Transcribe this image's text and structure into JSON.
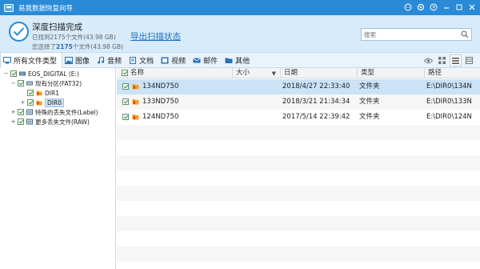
{
  "window": {
    "title": "易我数据恢复向导"
  },
  "header": {
    "status_title": "深度扫描完成",
    "found_prefix": "已找到",
    "found_count": "2175",
    "found_suffix": "个文件(43.98 GB)",
    "selected_prefix": "您选择了",
    "selected_count": "2175",
    "selected_suffix": "个文件(43.98 GB)",
    "export_link": "导出扫描状态",
    "search_placeholder": "搜索"
  },
  "toolbar": {
    "items": [
      {
        "label": "所有文件类型",
        "icon": "monitor-icon"
      },
      {
        "label": "图像",
        "icon": "image-icon"
      },
      {
        "label": "音频",
        "icon": "music-icon"
      },
      {
        "label": "文档",
        "icon": "document-icon"
      },
      {
        "label": "视频",
        "icon": "video-icon"
      },
      {
        "label": "邮件",
        "icon": "mail-icon"
      },
      {
        "label": "其他",
        "icon": "folder-icon"
      }
    ]
  },
  "tree": {
    "items": [
      {
        "label": "EOS_DIGITAL (E:)",
        "expander": "−"
      },
      {
        "label": "现有分区(FAT32)",
        "expander": "−"
      },
      {
        "label": "DIR1",
        "expander": ""
      },
      {
        "label": "DIR0",
        "expander": "+"
      },
      {
        "label": "特殊的丢失文件(Label)",
        "expander": "+"
      },
      {
        "label": "更多丢失文件(RAW)",
        "expander": "+"
      }
    ]
  },
  "table": {
    "columns": [
      "名称",
      "大小",
      "日期",
      "类型",
      "路径"
    ],
    "rows": [
      {
        "name": "134ND750",
        "size": "",
        "date": "2018/4/27 22:33:40",
        "type": "文件夹",
        "path": "E:\\DIR0\\134N"
      },
      {
        "name": "133ND750",
        "size": "",
        "date": "2018/3/21 21:34:34",
        "type": "文件夹",
        "path": "E:\\DIR0\\133N"
      },
      {
        "name": "124ND750",
        "size": "",
        "date": "2017/5/14 22:39:42",
        "type": "文件夹",
        "path": "E:\\DIR0\\124N"
      }
    ]
  },
  "colors": {
    "titlebar": "#2a8ad6",
    "header_bg": "#d8ebfa",
    "selected_row": "#cbe2f7",
    "link": "#1e6fbf"
  }
}
